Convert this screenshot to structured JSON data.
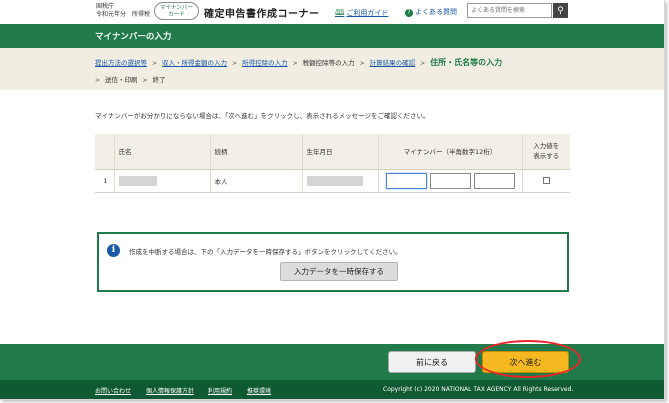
{
  "header": {
    "agency_line1": "国税庁",
    "agency_line2": "令和元年分　所得税",
    "mynumber_badge_line1": "マイナンバー",
    "mynumber_badge_line2": "カード",
    "site_title": "確定申告書作成コーナー",
    "guide_label": "ご利用ガイド",
    "faq_label": "よくある質問",
    "search_placeholder": "よくある質問を検索"
  },
  "page_title": "マイナンバーの入力",
  "breadcrumb": {
    "row1": [
      {
        "label": "提出方法の選択等",
        "state": "link"
      },
      {
        "label": "収入・所得金額の入力",
        "state": "link"
      },
      {
        "label": "所得控除の入力",
        "state": "link"
      },
      {
        "label": "税額控除等の入力",
        "state": "plain"
      },
      {
        "label": "計算結果の確認",
        "state": "link"
      },
      {
        "label": "住所・氏名等の入力",
        "state": "current"
      }
    ],
    "row2": [
      {
        "label": "送信・印刷",
        "state": "plain"
      },
      {
        "label": "終了",
        "state": "plain"
      }
    ]
  },
  "instruction": "マイナンバーがお分かりにならない場合は、「次へ進む」をクリックし、表示されるメッセージをご確認ください。",
  "table": {
    "headers": {
      "name": "氏名",
      "relationship": "続柄",
      "birthdate": "生年月日",
      "mynumber": "マイナンバー（半角数字12桁）",
      "show_line1": "入力値を",
      "show_line2": "表示する"
    },
    "rows": [
      {
        "no": "1",
        "name": "",
        "relationship": "本人",
        "birthdate": ""
      }
    ]
  },
  "info": {
    "text": "作成を中断する場合は、下の「入力データを一時保存する」ボタンをクリックしてください。",
    "save_button": "入力データを一時保存する"
  },
  "nav": {
    "back_label": "前に戻る",
    "next_label": "次へ進む"
  },
  "footer": {
    "links": [
      "お問い合わせ",
      "個人情報保護方針",
      "利用規約",
      "推奨環境"
    ],
    "copyright": "Copyright (c) 2020 NATIONAL TAX AGENCY All Rights Reserved."
  },
  "colors": {
    "brand_green": "#207a4a",
    "footer_green": "#0f5a33",
    "next_button": "#f5b820",
    "highlight_ring": "#e8262a",
    "link_blue": "#1a5aa8"
  }
}
